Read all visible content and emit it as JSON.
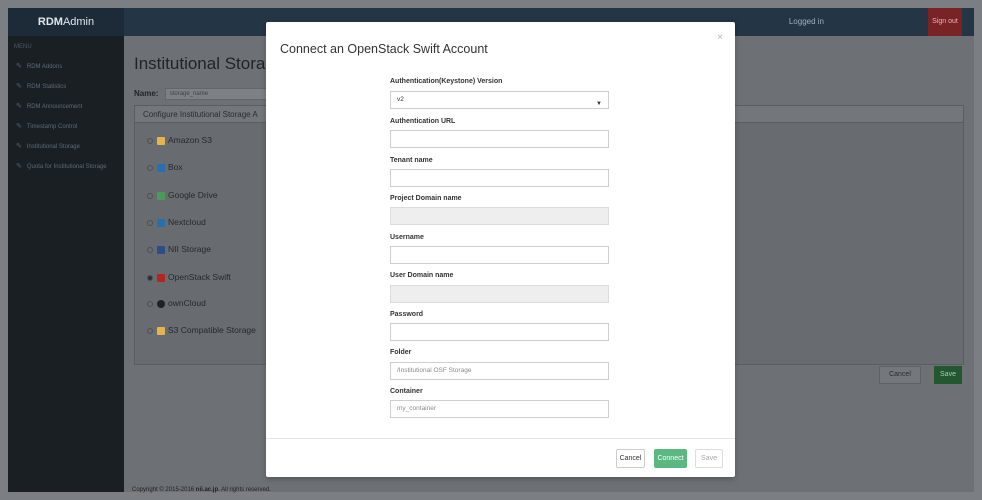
{
  "app": {
    "brand_bold": "RDM",
    "brand_rest": "Admin",
    "logged_in": "Logged in",
    "sign_out": "Sign out"
  },
  "sidebar": {
    "heading": "MENU",
    "items": [
      {
        "label": "RDM Addons"
      },
      {
        "label": "RDM Statistics"
      },
      {
        "label": "RDM Announcement"
      },
      {
        "label": "Timestamp Control"
      },
      {
        "label": "Institutional Storage"
      },
      {
        "label": "Quota for Institutional Storage"
      }
    ]
  },
  "main": {
    "title": "Institutional Storage",
    "name_label": "Name:",
    "name_value": "storage_name",
    "panel_header": "Configure Institutional Storage A",
    "providers": [
      {
        "label": "Amazon S3",
        "icon": "amazon-s3-icon",
        "color": "#e6b34c",
        "selected": false
      },
      {
        "label": "Box",
        "icon": "box-icon",
        "color": "#2a6db3",
        "selected": false
      },
      {
        "label": "Google Drive",
        "icon": "google-drive-icon",
        "color": "#4a9a5a",
        "selected": false
      },
      {
        "label": "Nextcloud",
        "icon": "nextcloud-icon",
        "color": "#2b6fa8",
        "selected": false
      },
      {
        "label": "NII Storage",
        "icon": "nii-storage-icon",
        "color": "#2a4f86",
        "selected": false
      },
      {
        "label": "OpenStack Swift",
        "icon": "openstack-swift-icon",
        "color": "#b3261e",
        "selected": true
      },
      {
        "label": "ownCloud",
        "icon": "owncloud-icon",
        "color": "#1f2326",
        "selected": false
      },
      {
        "label": "S3 Compatible Storage",
        "icon": "s3-compatible-icon",
        "color": "#e6b34c",
        "selected": false
      }
    ],
    "cancel_label": "Cancel",
    "save_label": "Save"
  },
  "footer": {
    "text": "Copyright © 2015-2016 ",
    "link": "nii.ac.jp",
    "suffix": ". All rights reserved."
  },
  "modal": {
    "title": "Connect an OpenStack Swift Account",
    "close": "×",
    "fields": {
      "auth_version_label": "Authentication(Keystone) Version",
      "auth_version_value": "v2",
      "auth_url_label": "Authentication URL",
      "tenant_label": "Tenant name",
      "project_domain_label": "Project Domain name",
      "username_label": "Username",
      "user_domain_label": "User Domain name",
      "password_label": "Password",
      "folder_label": "Folder",
      "folder_value": "/Institutional OSF Storage",
      "container_label": "Container",
      "container_value": "my_container"
    },
    "buttons": {
      "cancel": "Cancel",
      "connect": "Connect",
      "save": "Save"
    },
    "colors": {
      "connect": "#5cb881"
    }
  }
}
